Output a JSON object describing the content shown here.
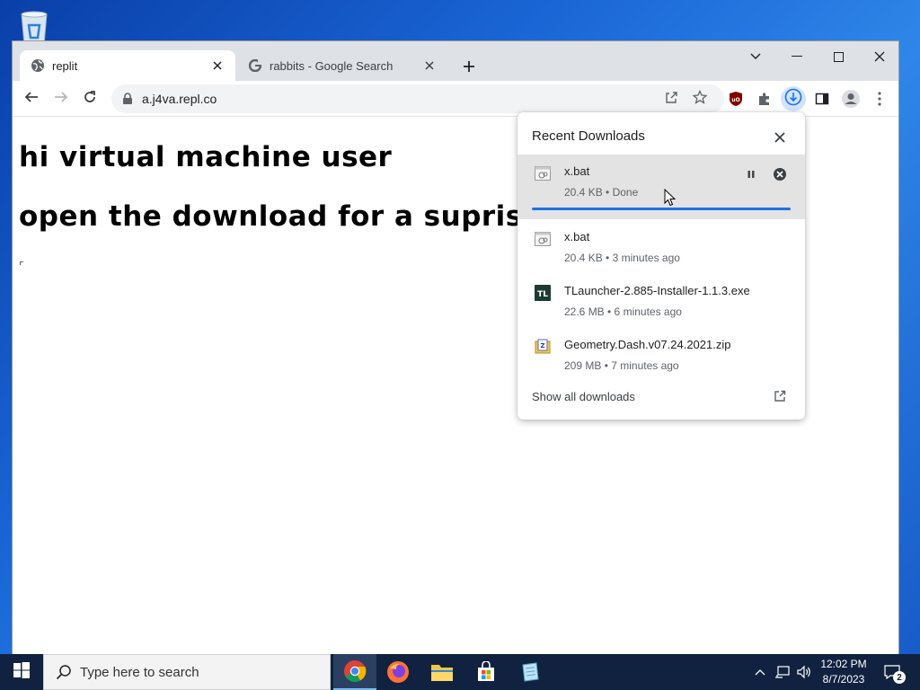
{
  "desktop": {
    "recycle_bin_icon": "recycle-bin-icon"
  },
  "browser": {
    "tabs": [
      {
        "title": "replit",
        "icon": "globe-icon",
        "active": true
      },
      {
        "title": "rabbits - Google Search",
        "icon": "google-icon",
        "active": false
      }
    ],
    "address": "a.j4va.repl.co",
    "toolbar_icons": [
      "back-arrow-icon",
      "forward-arrow-icon",
      "reload-icon",
      "lock-icon",
      "share-icon",
      "bookmark-star-icon",
      "ublock-icon",
      "extensions-puzzle-icon",
      "download-icon",
      "side-panel-icon",
      "profile-icon",
      "menu-dots-icon"
    ]
  },
  "page": {
    "line1": "hi virtual machine user",
    "line2": "open the download for a suprise"
  },
  "downloads": {
    "title": "Recent Downloads",
    "items": [
      {
        "name": "x.bat",
        "meta": "20.4 KB • Done",
        "icon": "bat-file-icon",
        "progress_pct": 100
      },
      {
        "name": "x.bat",
        "meta": "20.4 KB • 3 minutes ago",
        "icon": "bat-file-icon"
      },
      {
        "name": "TLauncher-2.885-Installer-1.1.3.exe",
        "meta": "22.6 MB • 6 minutes ago",
        "icon": "tlauncher-icon",
        "icon_text": "TL"
      },
      {
        "name": "Geometry.Dash.v07.24.2021.zip",
        "meta": "209 MB • 7 minutes ago",
        "icon": "zip-file-icon"
      }
    ],
    "show_all": "Show all downloads"
  },
  "taskbar": {
    "search_placeholder": "Type here to search",
    "time": "12:02 PM",
    "date": "8/7/2023",
    "notification_count": "2",
    "apps": [
      "chrome-icon",
      "firefox-icon",
      "file-explorer-icon",
      "microsoft-store-icon",
      "notepad-icon"
    ]
  },
  "colors": {
    "accent": "#1a73e8",
    "taskbar": "#10223f"
  }
}
